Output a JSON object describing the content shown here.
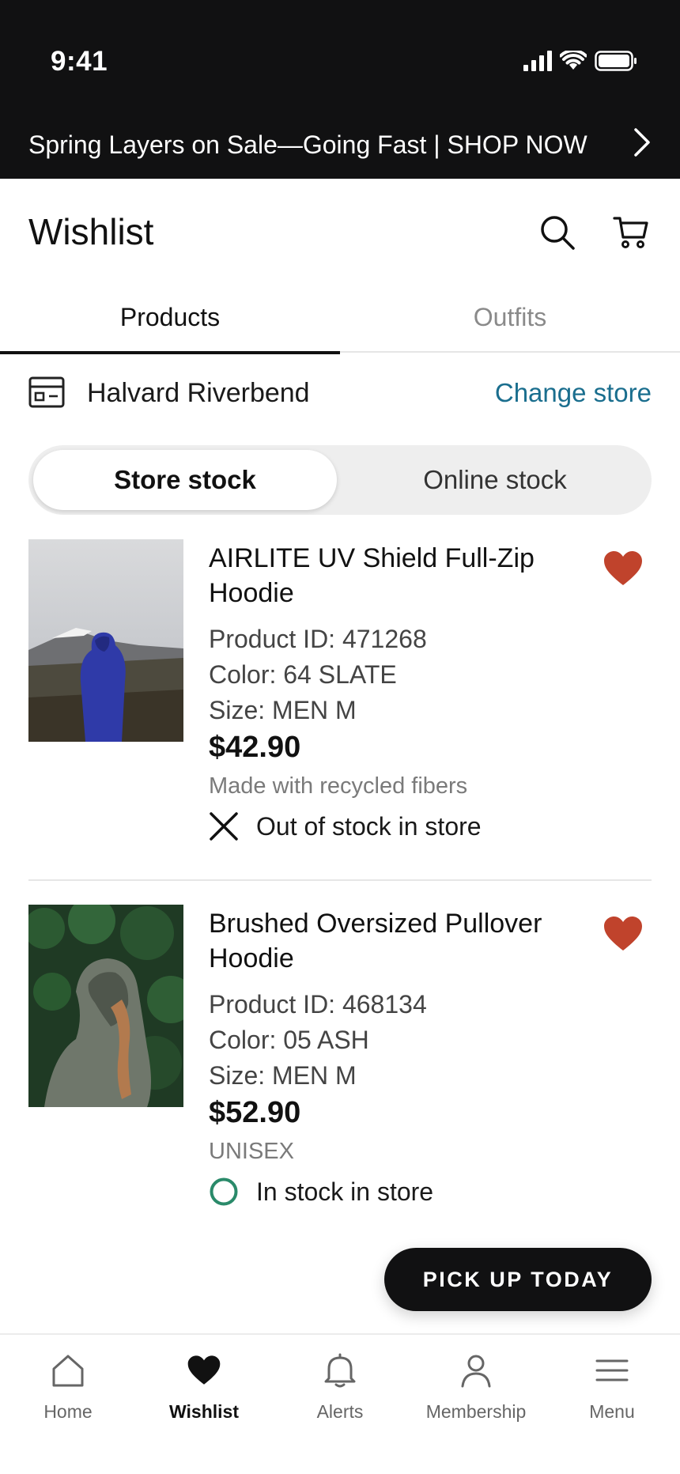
{
  "status_bar": {
    "time": "9:41"
  },
  "promo": {
    "text": "Spring Layers on Sale—Going Fast | SHOP NOW"
  },
  "header": {
    "title": "Wishlist"
  },
  "tabs": [
    {
      "label": "Products",
      "active": true
    },
    {
      "label": "Outfits",
      "active": false
    }
  ],
  "store": {
    "name": "Halvard Riverbend",
    "change_label": "Change store"
  },
  "stock_toggle": {
    "options": [
      "Store stock",
      "Online stock"
    ],
    "selected": "Store stock"
  },
  "products": [
    {
      "name": "AIRLITE UV Shield Full-Zip Hoodie",
      "product_id": "Product ID: 471268",
      "color": "Color: 64 SLATE",
      "size": "Size: MEN M",
      "price": "$42.90",
      "note": "Made with recycled fibers",
      "stock_status": "Out of stock in store",
      "stock_icon": "x-icon"
    },
    {
      "name": "Brushed Oversized Pullover Hoodie",
      "product_id": "Product ID: 468134",
      "color": "Color: 05 ASH",
      "size": "Size: MEN M",
      "price": "$52.90",
      "note": "UNISEX",
      "stock_status": "In stock in store",
      "stock_icon": "circle-icon"
    }
  ],
  "actions": {
    "pickup_label": "PICK UP TODAY"
  },
  "bottom_nav": [
    {
      "label": "Home",
      "icon": "home-icon",
      "active": false
    },
    {
      "label": "Wishlist",
      "icon": "heart-icon",
      "active": true
    },
    {
      "label": "Alerts",
      "icon": "bell-icon",
      "active": false
    },
    {
      "label": "Membership",
      "icon": "person-icon",
      "active": false
    },
    {
      "label": "Menu",
      "icon": "hamburger-icon",
      "active": false
    }
  ],
  "colors": {
    "accent_link": "#1a6e8e",
    "heart": "#c0432c",
    "in_stock": "#2a8a6a",
    "dark": "#111112"
  }
}
